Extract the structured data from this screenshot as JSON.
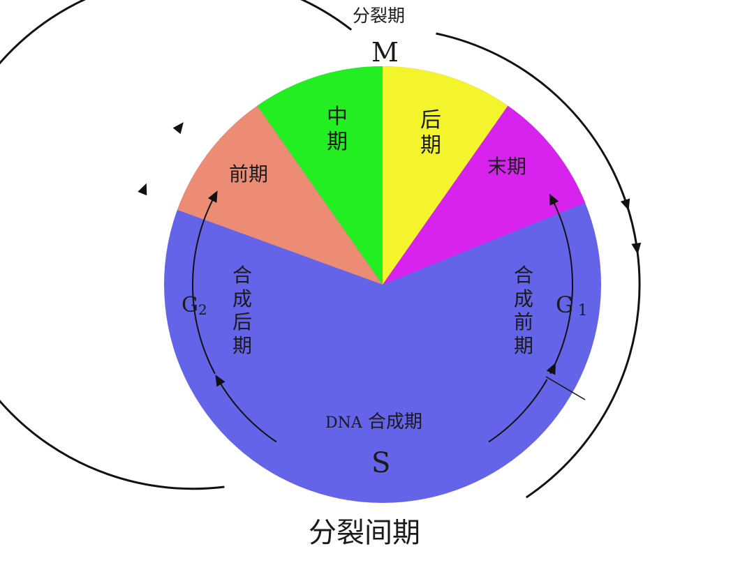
{
  "top_title": "分裂期",
  "m_letter": "M",
  "bottom_title": "分裂间期",
  "phases": {
    "prophase": "前期",
    "metaphase": [
      "中",
      "期"
    ],
    "anaphase": [
      "后",
      "期"
    ],
    "telophase": "末期"
  },
  "interphase": {
    "g1_label": "G",
    "g1_sub": "1",
    "g1_text": [
      "合",
      "成",
      "前",
      "期"
    ],
    "g2_label": "G",
    "g2_sub": "2",
    "g2_text": [
      "合",
      "成",
      "后",
      "期"
    ],
    "s_text_prefix": "DNA",
    "s_text": "合成期",
    "s_letter": "S"
  },
  "colors": {
    "interphase": "#6464e8",
    "prophase": "#ec8c74",
    "metaphase": "#22ee22",
    "anaphase": "#f4f42c",
    "telophase": "#d822ee",
    "line": "#111111"
  }
}
